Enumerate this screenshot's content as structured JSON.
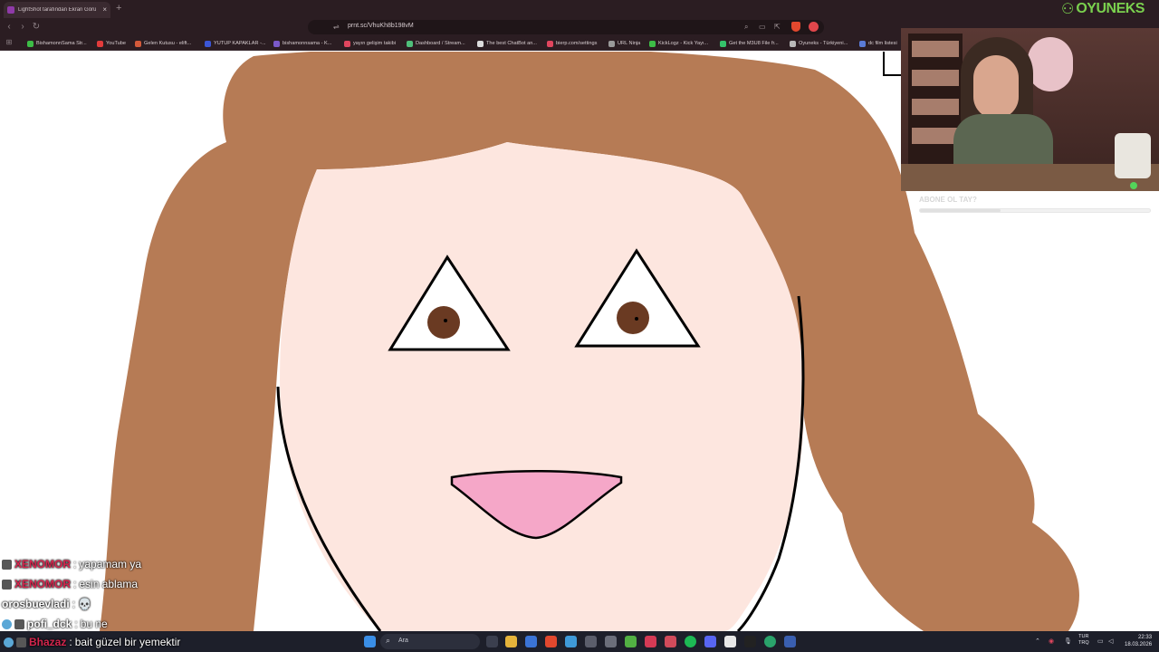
{
  "browser": {
    "tab": {
      "title": "LightShot tarafından Ekran Görü",
      "close": "×"
    },
    "new_tab": "+",
    "url": "prnt.sc/VhuKh8b198vM",
    "nav": {
      "back": "‹",
      "forward": "›",
      "reload": "↻"
    }
  },
  "bookmarks": [
    {
      "label": "BishamonnSama Str...",
      "color": "#3dbd46"
    },
    {
      "label": "YouTube",
      "color": "#e23b3b"
    },
    {
      "label": "Gelen Kutusu - elift...",
      "color": "#d35a3a"
    },
    {
      "label": "YUTUP KAPAKLAR -...",
      "color": "#3b56d6"
    },
    {
      "label": "bishamonnsama - K...",
      "color": "#7a59c9"
    },
    {
      "label": "yayın gelişim takibi",
      "color": "#e0465e"
    },
    {
      "label": "Dashboard / Stream...",
      "color": "#4fbf7a"
    },
    {
      "label": "The best ChatBot an...",
      "color": "#dcdcdc"
    },
    {
      "label": "bierp.com/settings",
      "color": "#e0465e"
    },
    {
      "label": "URL Ninja",
      "color": "#9a9a9a"
    },
    {
      "label": "KickLogz - Kick Yayı...",
      "color": "#3dbd46"
    },
    {
      "label": "Get the M3U8 File fr...",
      "color": "#35c26b"
    },
    {
      "label": "Oyuneks - Türkiyeni...",
      "color": "#b9b9b9"
    },
    {
      "label": "dc film listesi",
      "color": "#5a7bd6"
    }
  ],
  "overlay": {
    "brand": "OYUNEKS",
    "subscribe_label": "ABONE OL TAY?",
    "subscribe_progress": 0.35
  },
  "chat": [
    {
      "user": "XENOMOR",
      "user_color": "#d4264e",
      "sep": ":",
      "message": "yapamam ya"
    },
    {
      "user": "XENOMOR",
      "user_color": "#d4264e",
      "sep": ":",
      "message": "esin ablama"
    },
    {
      "user": "orosbuevladi",
      "user_color": "#ffffff",
      "sep": ":",
      "message": "💀"
    },
    {
      "user": "pofi_dck",
      "user_color": "#ffffff",
      "sep": ":",
      "message": "bu ne"
    }
  ],
  "bottom_chat": {
    "user": "Bhazaz",
    "user_color": "#d4264e",
    "sep": ":",
    "message": "bait güzel bir yemektir"
  },
  "taskbar": {
    "search_label": "Ara",
    "lang_top": "TUR",
    "lang_bottom": "TRQ",
    "time": "22:33",
    "date": "18.03.2026"
  },
  "colors": {
    "hair": "#b67b55",
    "skin": "#fde6df",
    "pupil": "#6a3a22",
    "mouth": "#f5a7c8",
    "outline": "#000000"
  }
}
